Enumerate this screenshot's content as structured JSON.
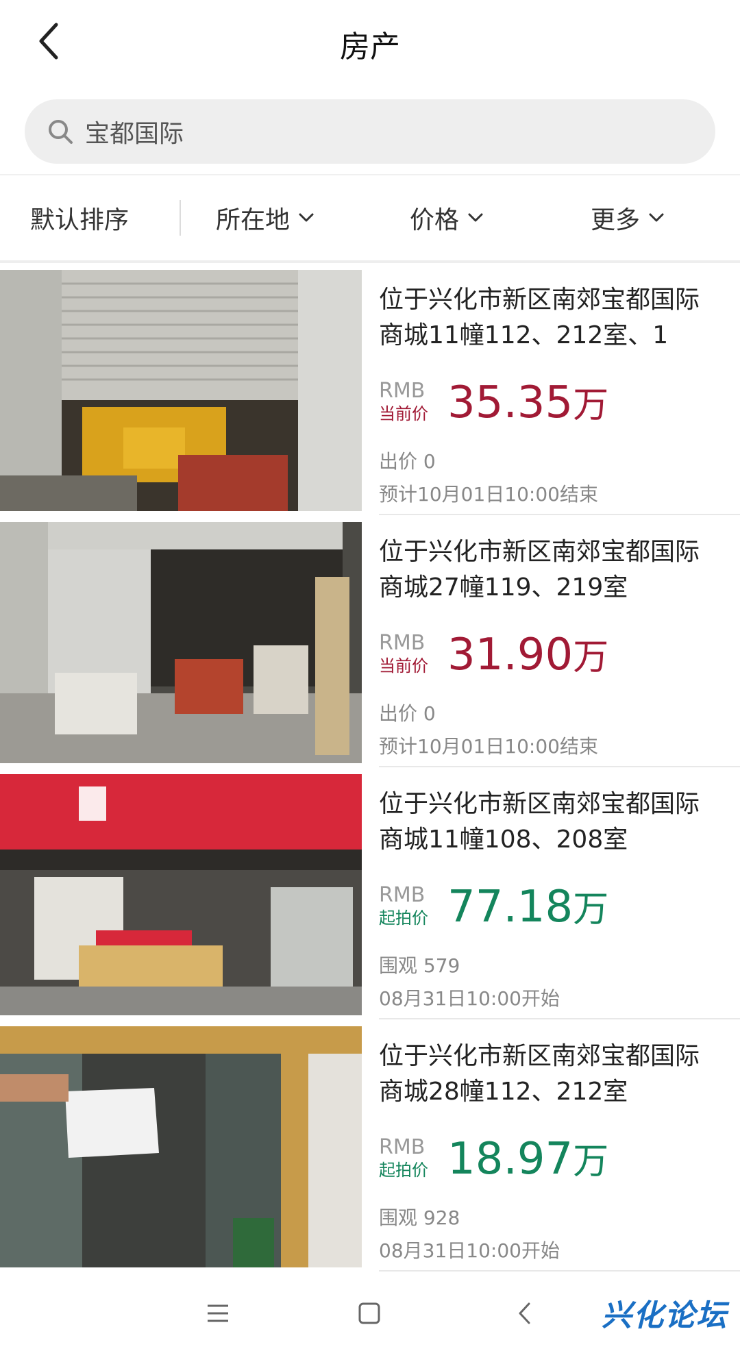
{
  "header": {
    "title": "房产",
    "back_icon": "chevron-left-icon"
  },
  "search": {
    "value": "宝都国际",
    "icon": "search-icon"
  },
  "filters": [
    {
      "label": "默认排序",
      "has_dropdown": false
    },
    {
      "label": "所在地",
      "has_dropdown": true
    },
    {
      "label": "价格",
      "has_dropdown": true
    },
    {
      "label": "更多",
      "has_dropdown": true
    }
  ],
  "colors": {
    "current_price": "#a11a35",
    "start_price": "#14855c",
    "muted": "#888888"
  },
  "listings": [
    {
      "title": "位于兴化市新区南郊宝都国际商城11幢112、212室、1",
      "currency": "RMB",
      "price_label": "当前价",
      "price_value": "35.35",
      "price_unit": "万",
      "price_type": "current",
      "meta1": "出价 0",
      "meta2": "预计10月01日10:00结束"
    },
    {
      "title": "位于兴化市新区南郊宝都国际商城27幢119、219室",
      "currency": "RMB",
      "price_label": "当前价",
      "price_value": "31.90",
      "price_unit": "万",
      "price_type": "current",
      "meta1": "出价 0",
      "meta2": "预计10月01日10:00结束"
    },
    {
      "title": "位于兴化市新区南郊宝都国际商城11幢108、208室",
      "currency": "RMB",
      "price_label": "起拍价",
      "price_value": "77.18",
      "price_unit": "万",
      "price_type": "start",
      "meta1": "围观 579",
      "meta2": "08月31日10:00开始"
    },
    {
      "title": "位于兴化市新区南郊宝都国际商城28幢112、212室",
      "currency": "RMB",
      "price_label": "起拍价",
      "price_value": "18.97",
      "price_unit": "万",
      "price_type": "start",
      "meta1": "围观 928",
      "meta2": "08月31日10:00开始"
    }
  ],
  "navbar": {
    "menu_icon": "menu-icon",
    "home_icon": "home-square-icon",
    "back_icon": "back-icon"
  },
  "watermark": "兴化论坛"
}
